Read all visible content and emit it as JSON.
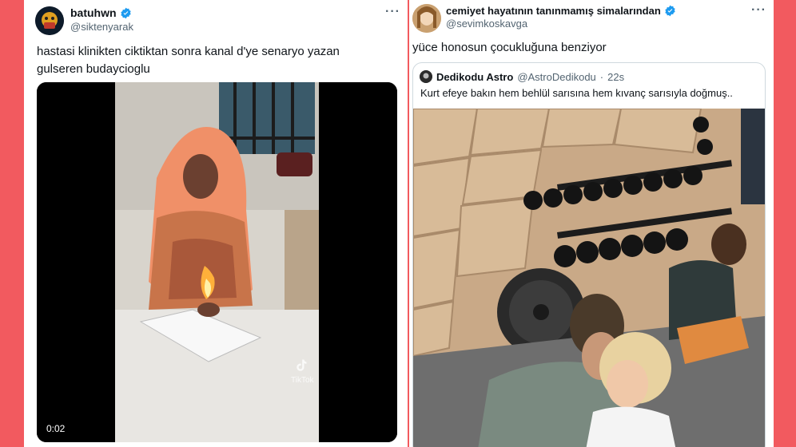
{
  "left_tweet": {
    "display_name": "batuhwn",
    "handle": "@siktenyarak",
    "text": "hastasi klinikten ciktiktan sonra kanal d'ye senaryo yazan gulseren budaycioglu",
    "video": {
      "duration": "0:02",
      "watermark": "TikTok"
    }
  },
  "right_tweet": {
    "display_name": "cemiyet hayatının tanınmamış simalarından",
    "handle": "@sevimkoskavga",
    "text": "yüce honosun çocukluğuna benziyor",
    "quoted": {
      "display_name": "Dedikodu Astro",
      "handle": "@AstroDedikodu",
      "time": "22s",
      "text": "Kurt efeye bakın hem behlül sarısına hem kıvanç sarısıyla doğmuş.."
    }
  },
  "colors": {
    "background": "#f25a5f",
    "verified": "#1d9bf0"
  },
  "icons": [
    "verified-icon",
    "more-icon",
    "tiktok-icon"
  ]
}
